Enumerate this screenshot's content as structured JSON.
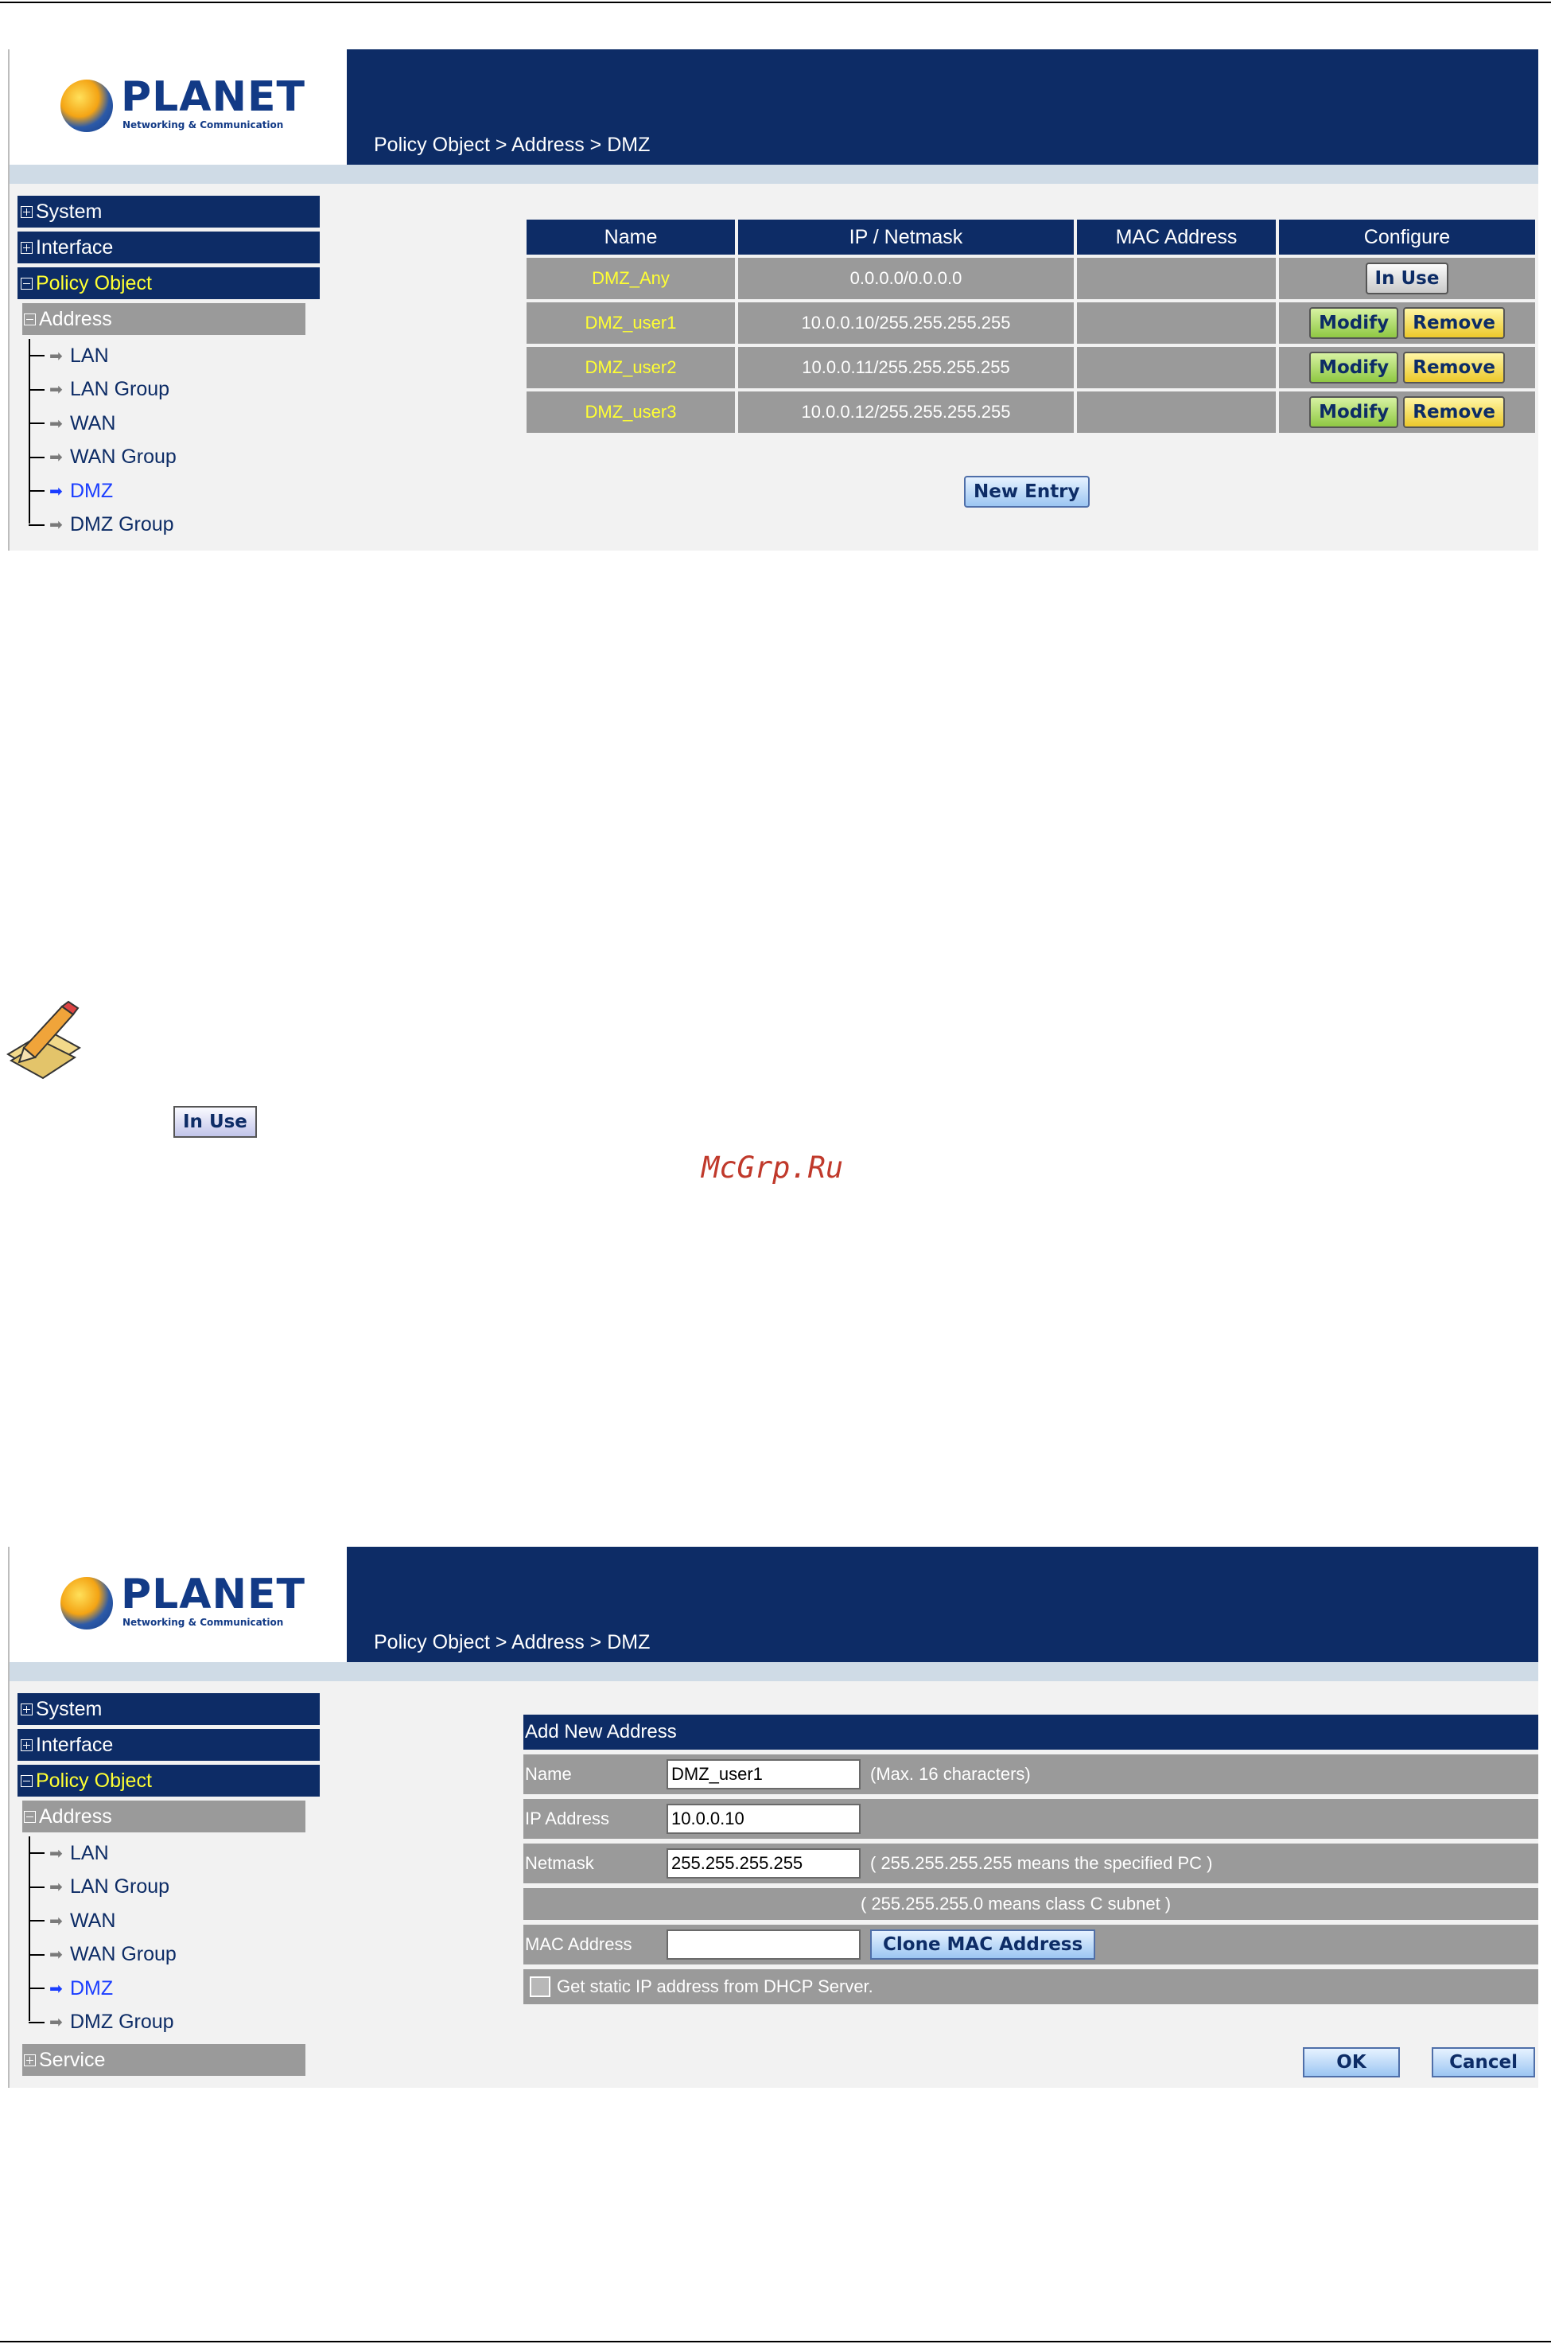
{
  "brand": {
    "name": "PLANET",
    "tagline": "Networking & Communication"
  },
  "breadcrumb": "Policy Object > Address > DMZ",
  "sidebar": {
    "menus": [
      "System",
      "Interface",
      "Policy Object"
    ],
    "submenu": "Address",
    "items": [
      "LAN",
      "LAN Group",
      "WAN",
      "WAN Group",
      "DMZ",
      "DMZ Group"
    ],
    "extra_menu": "Service"
  },
  "list_table": {
    "headers": [
      "Name",
      "IP / Netmask",
      "MAC Address",
      "Configure"
    ],
    "rows": [
      {
        "name": "DMZ_Any",
        "ip": "0.0.0.0/0.0.0.0",
        "mac": ""
      },
      {
        "name": "DMZ_user1",
        "ip": "10.0.0.10/255.255.255.255",
        "mac": ""
      },
      {
        "name": "DMZ_user2",
        "ip": "10.0.0.11/255.255.255.255",
        "mac": ""
      },
      {
        "name": "DMZ_user3",
        "ip": "10.0.0.12/255.255.255.255",
        "mac": ""
      }
    ],
    "buttons": {
      "in_use": "In Use",
      "modify": "Modify",
      "remove": "Remove",
      "new_entry": "New Entry"
    }
  },
  "note_button": "In Use",
  "watermark": "McGrp.Ru",
  "form": {
    "title": "Add New Address",
    "name_label": "Name",
    "name_value": "DMZ_user1",
    "name_note": "(Max. 16 characters)",
    "ip_label": "IP Address",
    "ip_value": "10.0.0.10",
    "netmask_label": "Netmask",
    "netmask_value": "255.255.255.255",
    "netmask_note1": "( 255.255.255.255 means the specified PC )",
    "netmask_note2": "( 255.255.255.0 means class C subnet )",
    "mac_label": "MAC Address",
    "mac_value": "",
    "clone_button": "Clone MAC Address",
    "dhcp_label": "Get static IP address from DHCP Server.",
    "ok": "OK",
    "cancel": "Cancel"
  }
}
